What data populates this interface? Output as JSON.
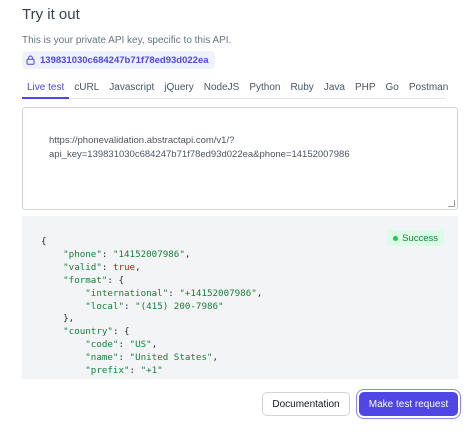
{
  "header": {
    "title": "Try it out",
    "description": "This is your private API key, specific to this API.",
    "api_key": "139831030c684247b71f78ed93d022ea"
  },
  "tabs": [
    {
      "label": "Live test",
      "active": true
    },
    {
      "label": "cURL"
    },
    {
      "label": "Javascript"
    },
    {
      "label": "jQuery"
    },
    {
      "label": "NodeJS"
    },
    {
      "label": "Python"
    },
    {
      "label": "Ruby"
    },
    {
      "label": "Java"
    },
    {
      "label": "PHP"
    },
    {
      "label": "Go"
    },
    {
      "label": "Postman"
    }
  ],
  "request": {
    "url_line1": "https://phonevalidation.abstractapi.com/v1/?",
    "url_line2": "api_key=139831030c684247b71f78ed93d022ea&phone=14152007986"
  },
  "response": {
    "status": "Success",
    "phone": "\"14152007986\"",
    "valid": "true",
    "international": "\"+14152007986\"",
    "local": "\"(415) 200-7986\"",
    "country_code": "\"US\"",
    "country_name": "\"United States\"",
    "country_prefix": "\"+1\""
  },
  "buttons": {
    "documentation": "Documentation",
    "make_request": "Make test request"
  },
  "colors": {
    "accent": "#4f46e5",
    "success": "#15803d"
  }
}
